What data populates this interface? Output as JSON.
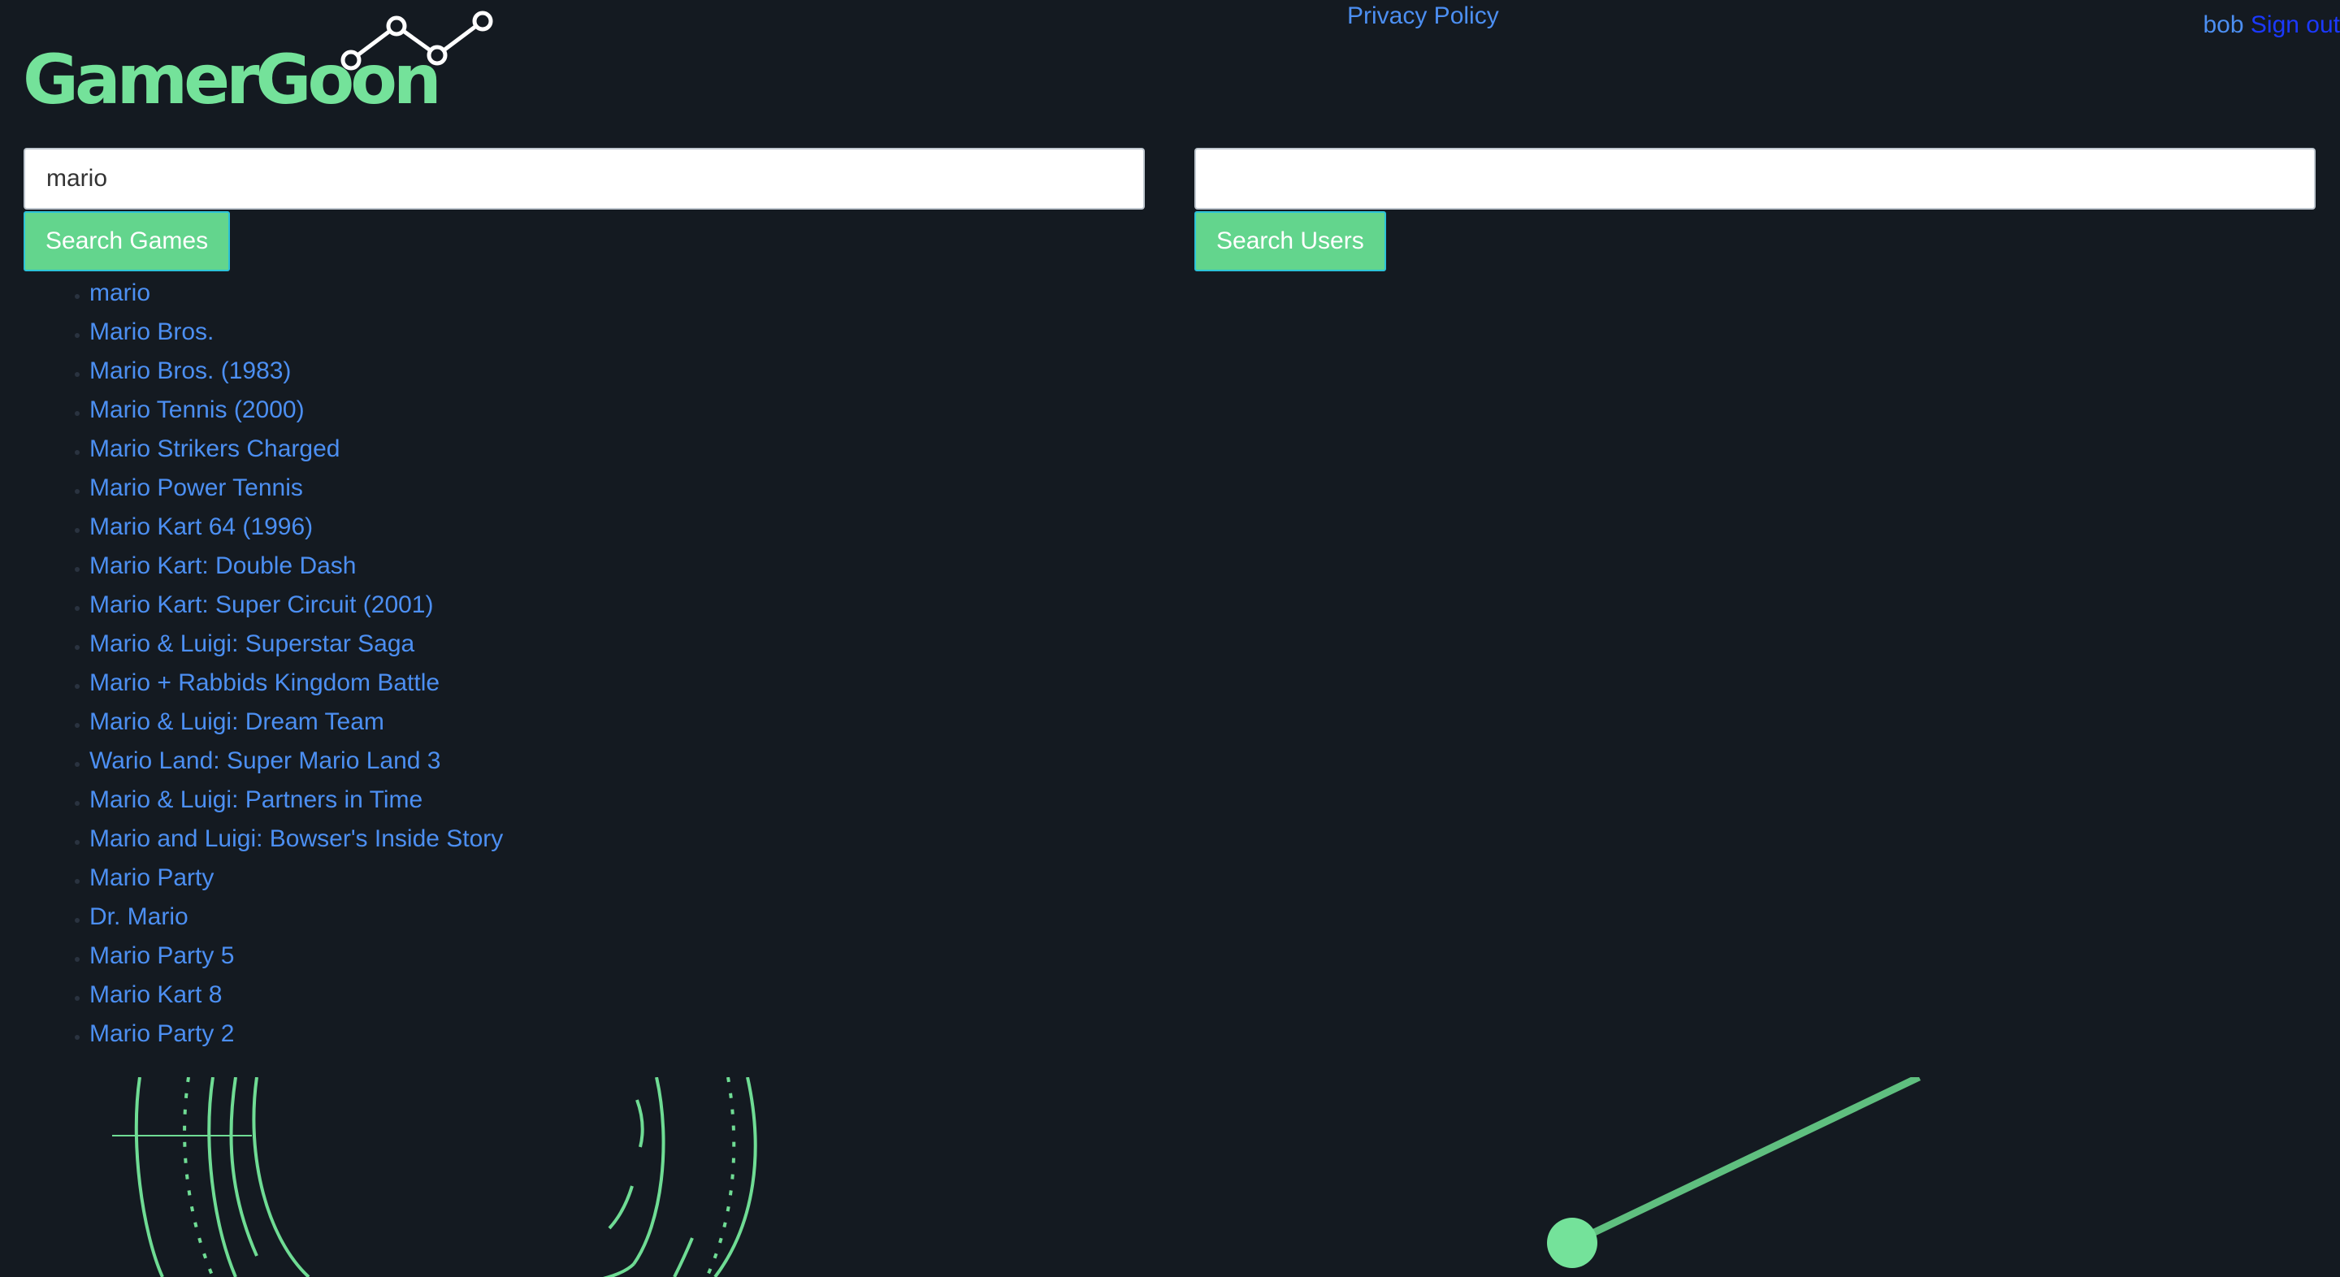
{
  "brand": {
    "logo_text": "GamerGoon",
    "accent_color": "#74e29a"
  },
  "nav": {
    "privacy_label": "Privacy Policy"
  },
  "user": {
    "name": "bob",
    "signout_label": "Sign out"
  },
  "game_search": {
    "value": "mario",
    "button_label": "Search Games"
  },
  "user_search": {
    "value": "",
    "button_label": "Search Users"
  },
  "results": [
    "mario",
    "Mario Bros.",
    "Mario Bros. (1983)",
    "Mario Tennis (2000)",
    "Mario Strikers Charged",
    "Mario Power Tennis",
    "Mario Kart 64 (1996)",
    "Mario Kart: Double Dash",
    "Mario Kart: Super Circuit (2001)",
    "Mario & Luigi: Superstar Saga",
    "Mario + Rabbids Kingdom Battle",
    "Mario & Luigi: Dream Team",
    "Wario Land: Super Mario Land 3",
    "Mario & Luigi: Partners in Time",
    "Mario and Luigi: Bowser's Inside Story",
    "Mario Party",
    "Dr. Mario",
    "Mario Party 5",
    "Mario Kart 8",
    "Mario Party 2"
  ],
  "colors": {
    "background": "#141a21",
    "link": "#4c8ff2",
    "signout": "#1b39ff",
    "button": "#63d58d"
  }
}
